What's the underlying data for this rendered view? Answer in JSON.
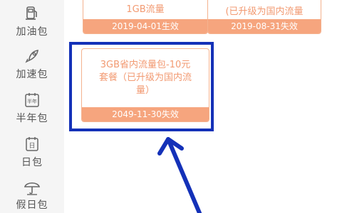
{
  "sidebar": {
    "items": [
      {
        "label": "加油包",
        "icon": "fuel-pump-icon"
      },
      {
        "label": "加速包",
        "icon": "rocket-icon"
      },
      {
        "label": "半年包",
        "icon": "half-year-calendar-icon",
        "icon_text": "半年"
      },
      {
        "label": "日包",
        "icon": "day-calendar-icon",
        "icon_text": "日"
      },
      {
        "label": "假日包",
        "icon": "umbrella-icon"
      }
    ]
  },
  "cards": [
    {
      "title": "1GB流量",
      "footer": "2019-04-01生效"
    },
    {
      "title": "(已升级为国内流量",
      "footer": "2019-08-31失效"
    },
    {
      "title_lines": [
        "3GB省内流量包-10元",
        "套餐（已升级为国内流",
        "量）"
      ],
      "footer": "2049-11-30失效"
    }
  ],
  "colors": {
    "card_border": "#f4b28f",
    "card_text": "#f29a72",
    "card_footer": "#f6a57e",
    "highlight": "#1431b8"
  }
}
